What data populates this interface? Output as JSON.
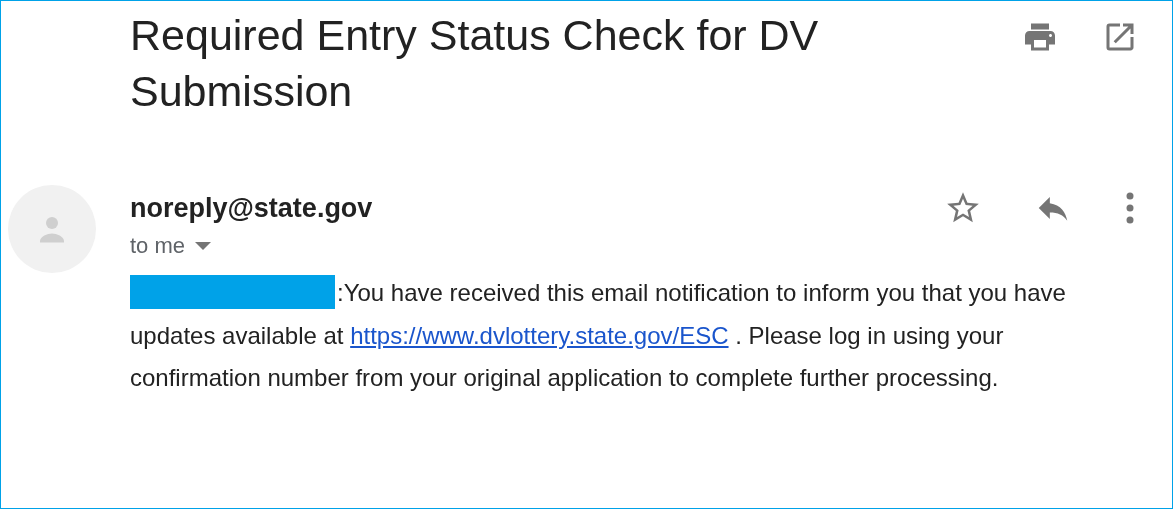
{
  "subject": "Required Entry Status Check for DV Submission",
  "sender": {
    "address": "noreply@state.gov",
    "recipient": "to me"
  },
  "body": {
    "redacted": true,
    "before": ":You have received this email notification to inform you that you have updates available at",
    "link": "https://www.dvlottery.state.gov/ESC",
    "after": ". Please log in using your confirmation number from your original application to complete further processing."
  }
}
